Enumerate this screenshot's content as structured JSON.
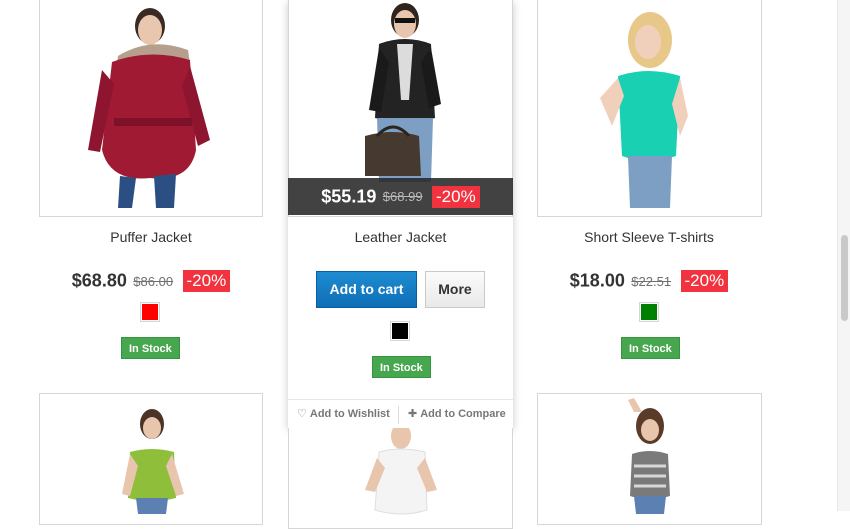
{
  "products": [
    {
      "name": "Puffer Jacket",
      "price": "$68.80",
      "old_price": "$86.00",
      "discount": "-20%",
      "color": "#ff0000",
      "stock": "In Stock"
    },
    {
      "name": "Leather Jacket",
      "price": "$55.19",
      "old_price": "$68.99",
      "discount": "-20%",
      "color": "#000000",
      "stock": "In Stock"
    },
    {
      "name": "Short Sleeve T-shirts",
      "price": "$18.00",
      "old_price": "$22.51",
      "discount": "-20%",
      "color": "#008000",
      "stock": "In Stock"
    }
  ],
  "hover_card": {
    "add_to_cart": "Add to cart",
    "more": "More",
    "add_to_wishlist": "Add to Wishlist",
    "add_to_compare": "Add to Compare"
  },
  "icons": {
    "wishlist": "heart-icon",
    "compare": "plus-icon"
  }
}
